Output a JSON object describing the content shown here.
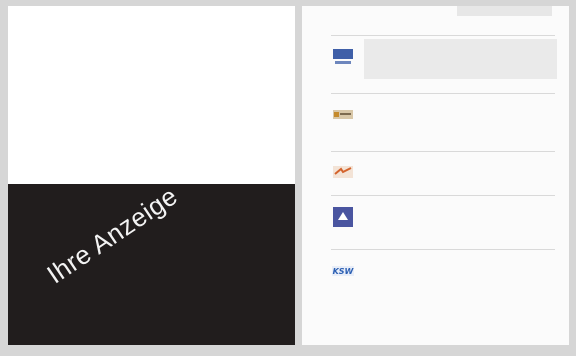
{
  "left_page": {
    "ad_text": "Ihre Anzeige"
  },
  "right_page": {
    "header_tag": "",
    "sections": [
      {
        "title": "",
        "logo_caption": "",
        "logo_color": "#3f5fa8",
        "description": "",
        "contact_name": "",
        "contact_lines": "",
        "highlighted": true
      },
      {
        "title": "",
        "logo_caption": "",
        "logo_color": "#c58a2c",
        "description": "",
        "contact_name": "",
        "contact_lines": "",
        "highlighted": false
      },
      {
        "title": "",
        "logo_caption": "",
        "logo_color": "#d4632c",
        "description": "",
        "contact_name": "",
        "contact_lines": "",
        "highlighted": false
      },
      {
        "title": "",
        "logo_caption": "",
        "logo_color": "#4a55a0",
        "description": "",
        "contact_name": "",
        "contact_lines": "",
        "highlighted": false
      },
      {
        "title": "",
        "logo_caption": "KSW",
        "logo_color": "#2b5fb3",
        "description": "",
        "contact_name": "",
        "contact_lines": "",
        "highlighted": false
      }
    ],
    "page_number": ""
  }
}
